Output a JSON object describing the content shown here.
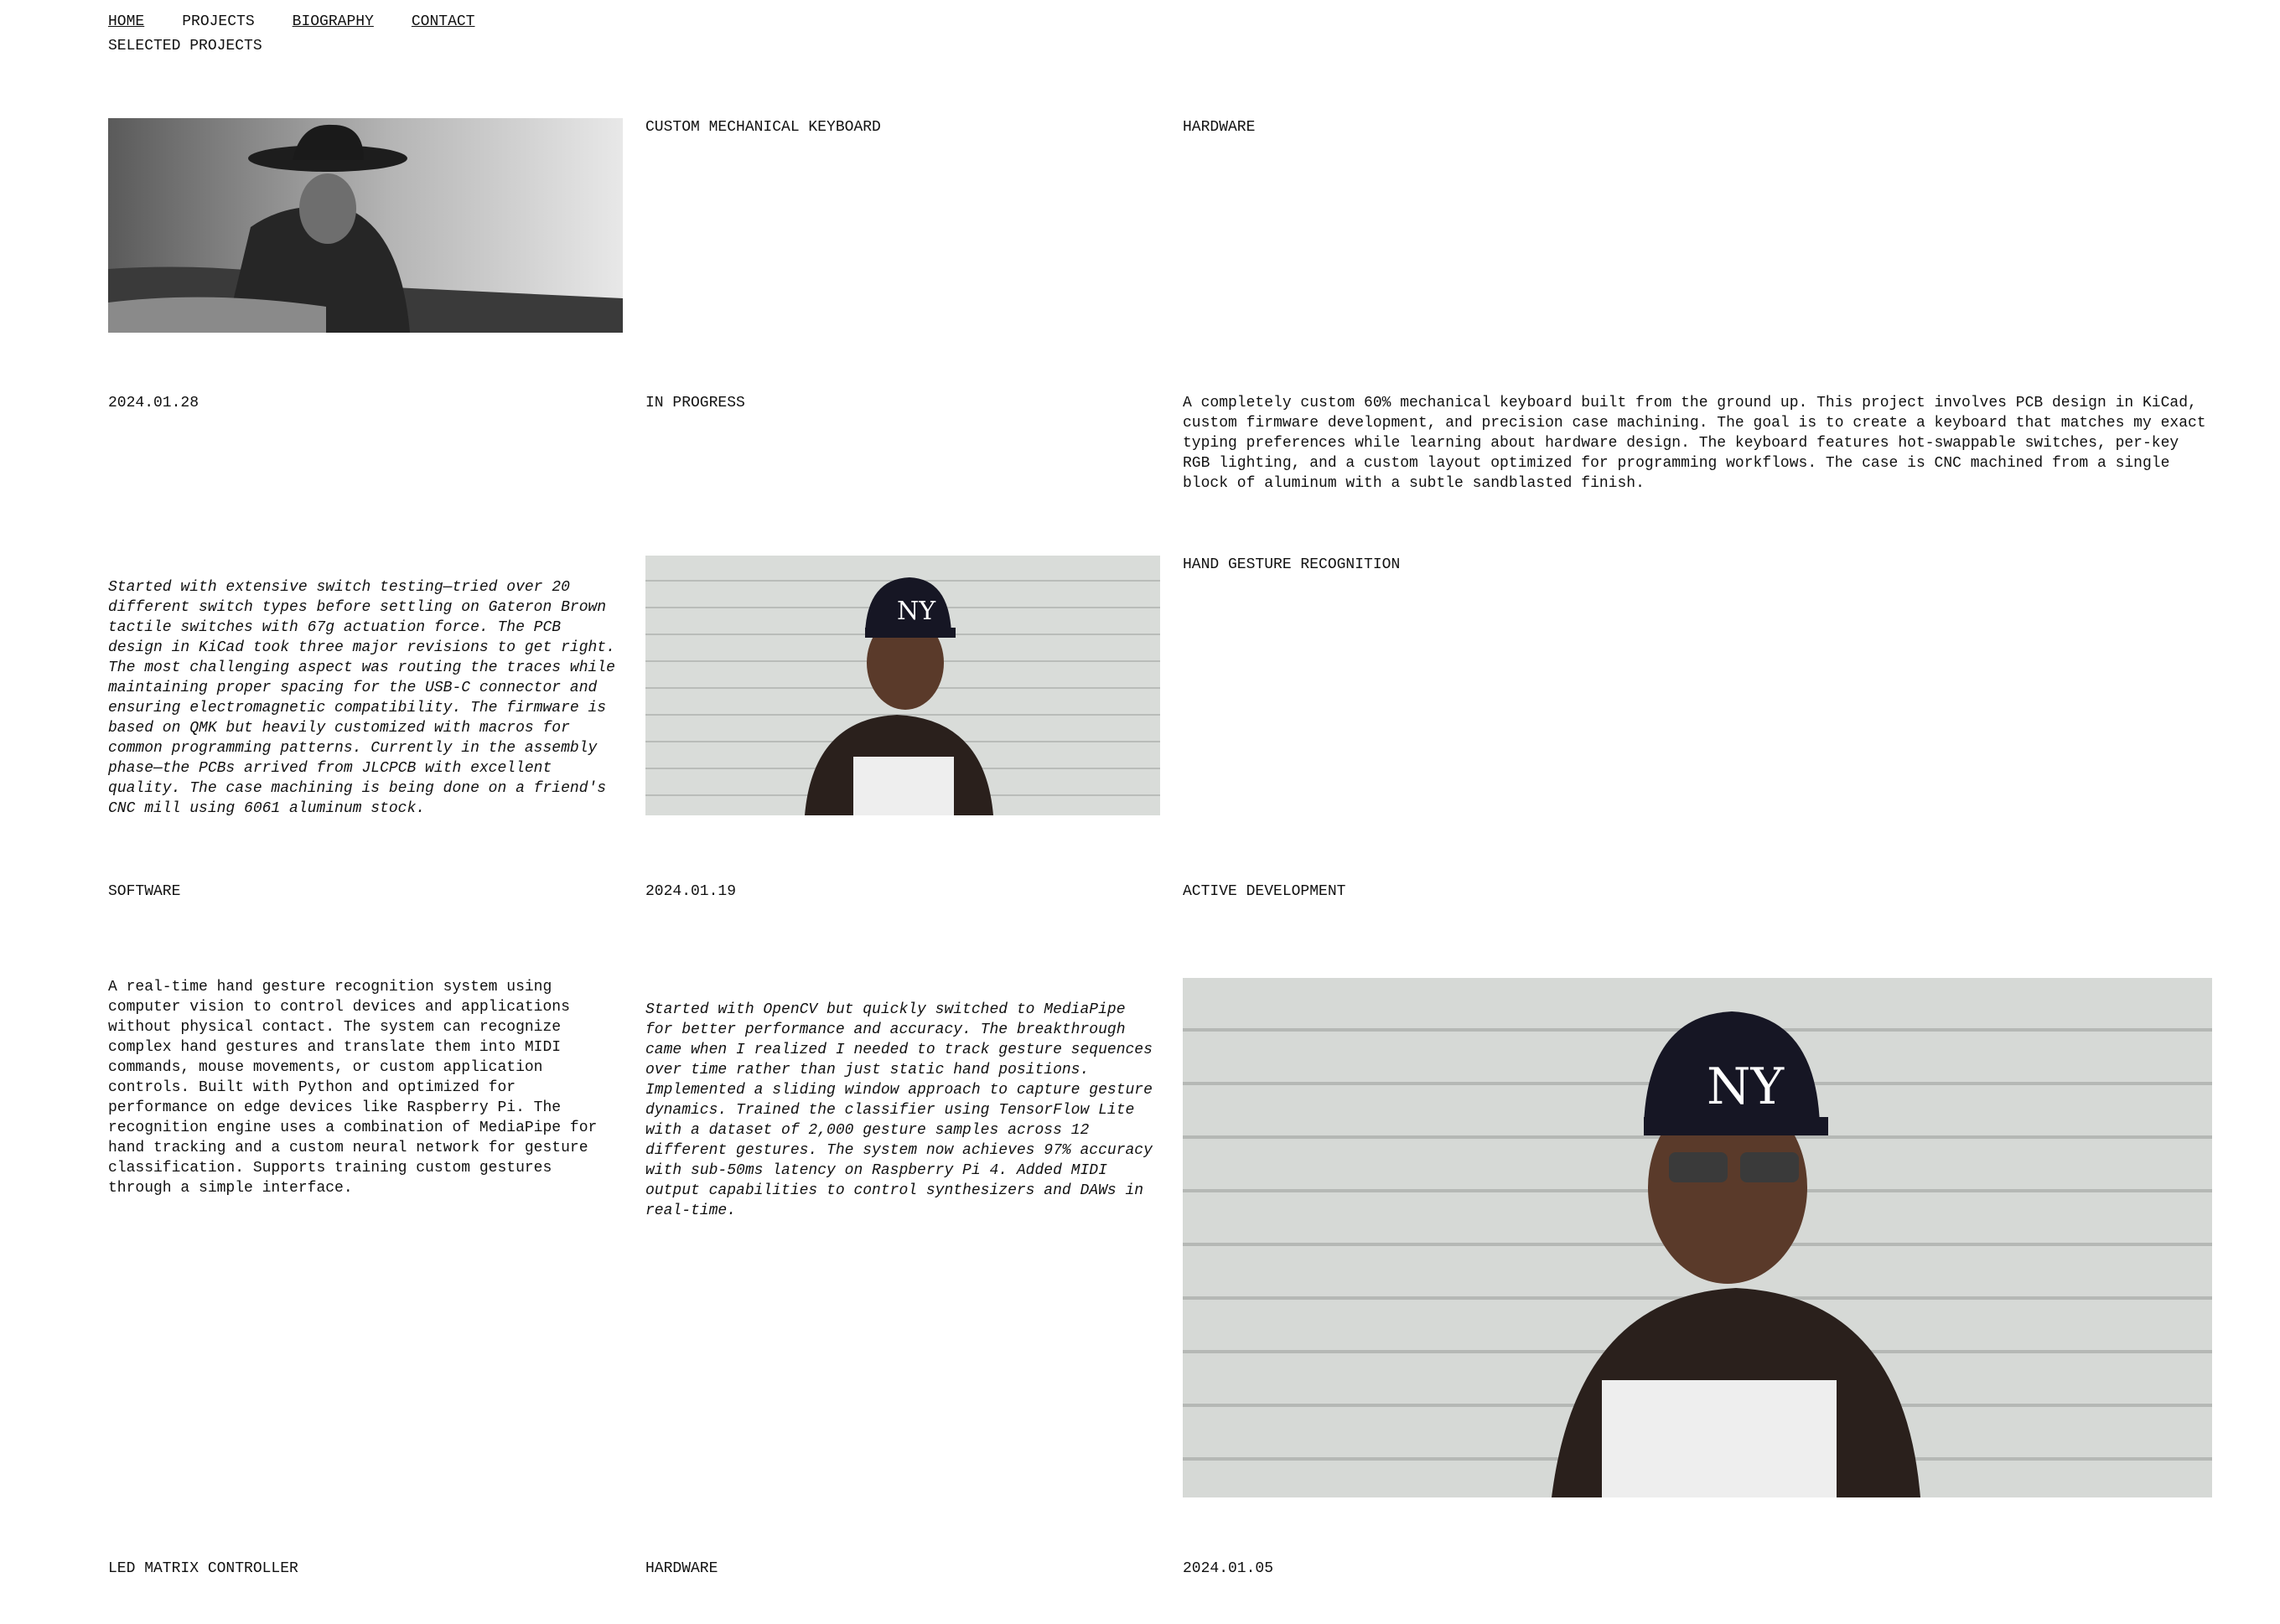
{
  "nav": {
    "home": "HOME",
    "projects": "PROJECTS",
    "biography": "BIOGRAPHY",
    "contact": "CONTACT"
  },
  "section_title": "SELECTED PROJECTS",
  "projects": [
    {
      "title": "CUSTOM MECHANICAL KEYBOARD",
      "category": "HARDWARE",
      "date": "2024.01.28",
      "status": "IN PROGRESS",
      "description": "A completely custom 60% mechanical keyboard built from the ground up. This project involves PCB design in KiCad, custom firmware development, and precision case machining. The goal is to create a keyboard that matches my exact typing preferences while learning about hardware design. The keyboard features hot-swappable switches, per-key RGB lighting, and a custom layout optimized for programming workflows. The case is CNC machined from a single block of aluminum with a subtle sandblasted finish.",
      "notes": "Started with extensive switch testing—tried over 20 different switch types before settling on Gateron Brown tactile switches with 67g actuation force. The PCB design in KiCad took three major revisions to get right. The most challenging aspect was routing the traces while maintaining proper spacing for the USB-C connector and ensuring electromagnetic compatibility. The firmware is based on QMK but heavily customized with macros for common programming patterns. Currently in the assembly phase—the PCBs arrived from JLCPCB with excellent quality. The case machining is being done on a friend's CNC mill using 6061 aluminum stock.",
      "image": "cowboy-portrait-photo"
    },
    {
      "title": "HAND GESTURE RECOGNITION",
      "category": "SOFTWARE",
      "date": "2024.01.19",
      "status": "ACTIVE DEVELOPMENT",
      "description": "A real-time hand gesture recognition system using computer vision to control devices and applications without physical contact. The system can recognize complex hand gestures and translate them into MIDI commands, mouse movements, or custom application controls. Built with Python and optimized for performance on edge devices like Raspberry Pi. The recognition engine uses a combination of MediaPipe for hand tracking and a custom neural network for gesture classification. Supports training custom gestures through a simple interface.",
      "notes": "Started with OpenCV but quickly switched to MediaPipe for better performance and accuracy. The breakthrough came when I realized I needed to track gesture sequences over time rather than just static hand positions. Implemented a sliding window approach to capture gesture dynamics. Trained the classifier using TensorFlow Lite with a dataset of 2,000 gesture samples across 12 different gestures. The system now achieves 97% accuracy with sub-50ms latency on Raspberry Pi 4. Added MIDI output capabilities to control synthesizers and DAWs in real-time.",
      "image": "man-in-ny-cap-photo"
    },
    {
      "title": "LED MATRIX CONTROLLER",
      "category": "HARDWARE",
      "date": "2024.01.05"
    }
  ],
  "colors": {
    "background": "#ffffff",
    "text": "#111111"
  }
}
